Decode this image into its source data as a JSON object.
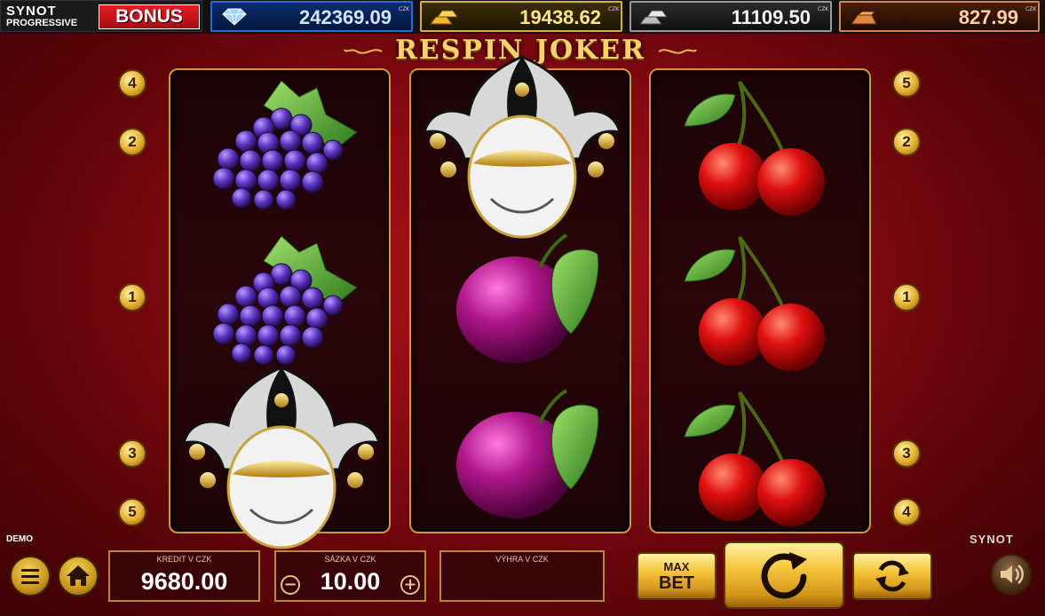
{
  "brand": {
    "synot": "SYNOT",
    "progressive": "PROGRESSIVE",
    "bonus": "BONUS"
  },
  "jackpots": [
    {
      "name": "diamond",
      "value": "242369.09",
      "currency": "CZK",
      "icon": "diamond-icon"
    },
    {
      "name": "gold",
      "value": "19438.62",
      "currency": "CZK",
      "icon": "gold-bars-icon"
    },
    {
      "name": "silver",
      "value": "11109.50",
      "currency": "CZK",
      "icon": "silver-bars-icon"
    },
    {
      "name": "bronze",
      "value": "827.99",
      "currency": "CZK",
      "icon": "bronze-bar-icon"
    }
  ],
  "game_title": "RESPIN JOKER",
  "reels": [
    [
      "grapes",
      "grapes",
      "joker"
    ],
    [
      "joker",
      "plum",
      "plum"
    ],
    [
      "cherries",
      "cherries",
      "cherries"
    ]
  ],
  "paylines": {
    "left": [
      "4",
      "2",
      "1",
      "3",
      "5"
    ],
    "right": [
      "5",
      "2",
      "1",
      "3",
      "4"
    ]
  },
  "demo_label": "DEMO",
  "synot_mark": "SYNOT",
  "credit": {
    "label": "KREDIT V CZK",
    "value": "9680.00"
  },
  "bet": {
    "label": "SÁZKA V CZK",
    "value": "10.00",
    "minus": "−",
    "plus": "+"
  },
  "win": {
    "label": "VÝHRA V CZK",
    "value": ""
  },
  "buttons": {
    "max_bet_1": "MAX",
    "max_bet_2": "BET"
  },
  "colors": {
    "accent_gold": "#f5c43a",
    "reel_frame": "#c99a38",
    "background": "#8a0a12"
  }
}
